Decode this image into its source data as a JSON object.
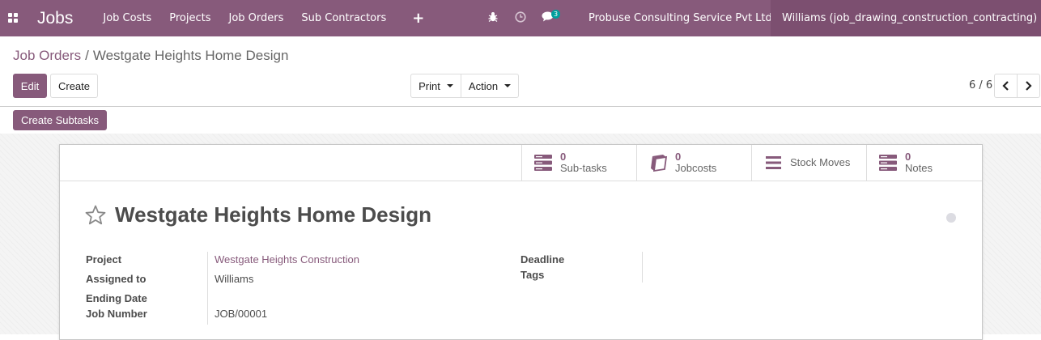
{
  "navbar": {
    "app_name": "Jobs",
    "menu": [
      "Job Costs",
      "Projects",
      "Job Orders",
      "Sub Contractors"
    ],
    "plus": "+",
    "badge_count": "3",
    "company": "Probuse Consulting Service Pvt Ltd",
    "user": "Williams (job_drawing_construction_contracting)",
    "color": "#875a7b"
  },
  "breadcrumb": {
    "parent": "Job Orders",
    "separator": "/",
    "current": "Westgate Heights Home Design"
  },
  "controls": {
    "edit": "Edit",
    "create": "Create",
    "print": "Print",
    "action": "Action",
    "pager": "6 / 6"
  },
  "statusbar": {
    "create_subtasks": "Create Subtasks"
  },
  "smart_buttons": [
    {
      "value": "0",
      "label": "Sub-tasks",
      "icon": "server-icon"
    },
    {
      "value": "0",
      "label": "Jobcosts",
      "icon": "book-icon"
    },
    {
      "value": "",
      "label": "Stock Moves",
      "icon": "list-icon"
    },
    {
      "value": "0",
      "label": "Notes",
      "icon": "server-icon"
    }
  ],
  "record": {
    "title": "Westgate Heights Home Design"
  },
  "fields": {
    "project_label": "Project",
    "project_value": "Westgate Heights Construction",
    "assigned_label": "Assigned to",
    "assigned_value": "Williams",
    "ending_label": "Ending Date",
    "ending_value": "",
    "job_number_label": "Job Number",
    "job_number_value": "JOB/00001",
    "deadline_label": "Deadline",
    "tags_label": "Tags"
  }
}
